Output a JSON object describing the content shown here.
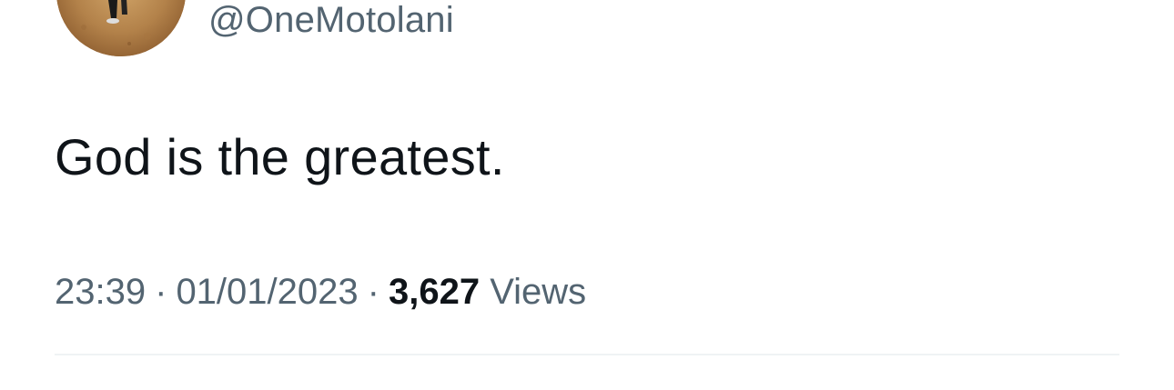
{
  "author": {
    "handle": "@OneMotolani",
    "avatar_icon": "profile-photo"
  },
  "tweet": {
    "text": "God is the greatest.",
    "time": "23:39",
    "separator": "·",
    "date": "01/01/2023",
    "views_count": "3,627",
    "views_label": "Views"
  },
  "colors": {
    "text_primary": "#0f1419",
    "text_secondary": "#536471",
    "divider": "#eff3f4"
  }
}
